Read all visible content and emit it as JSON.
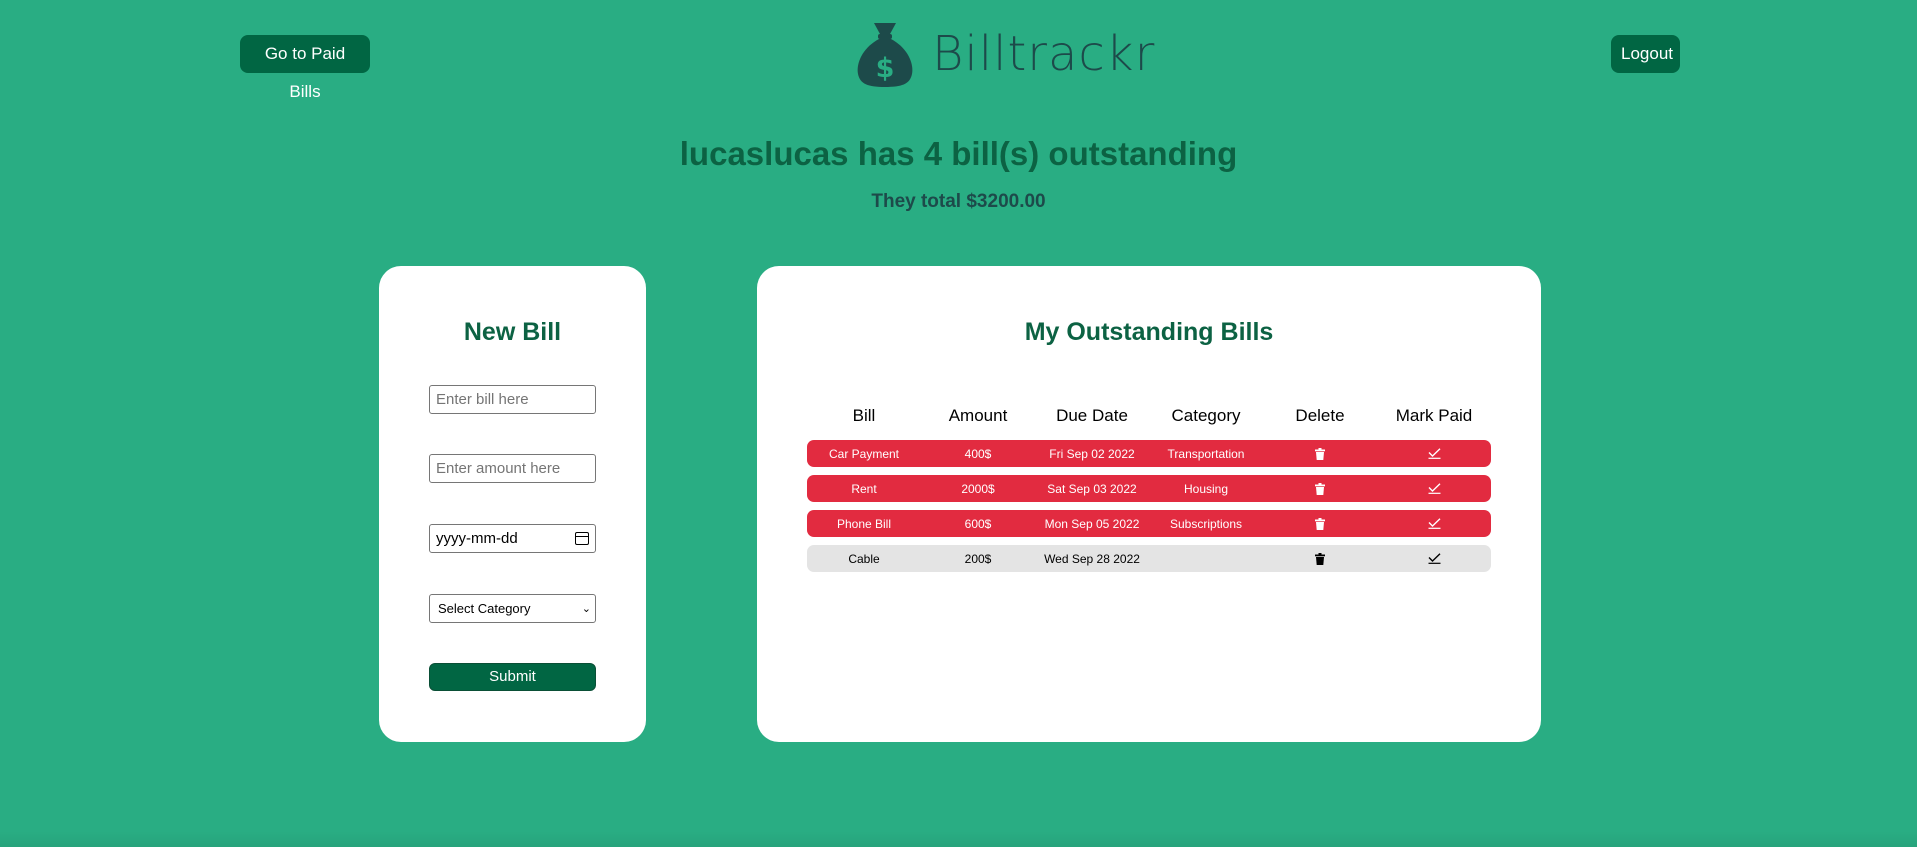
{
  "header": {
    "paid_bills_label": "Go to Paid Bills",
    "brand": "Billtrackr",
    "logout_label": "Logout"
  },
  "summary": {
    "headline": "lucaslucas has 4 bill(s) outstanding",
    "total": "They total $3200.00"
  },
  "new_bill": {
    "title": "New Bill",
    "bill_placeholder": "Enter bill here",
    "amount_placeholder": "Enter amount here",
    "date_placeholder": "yyyy-mm-dd",
    "category_placeholder": "Select Category",
    "submit_label": "Submit"
  },
  "bills": {
    "title": "My Outstanding Bills",
    "columns": [
      "Bill",
      "Amount",
      "Due Date",
      "Category",
      "Delete",
      "Mark Paid"
    ],
    "rows": [
      {
        "bill": "Car Payment",
        "amount": "400$",
        "due": "Fri Sep 02 2022",
        "category": "Transportation",
        "status": "overdue"
      },
      {
        "bill": "Rent",
        "amount": "2000$",
        "due": "Sat Sep 03 2022",
        "category": "Housing",
        "status": "overdue"
      },
      {
        "bill": "Phone Bill",
        "amount": "600$",
        "due": "Mon Sep 05 2022",
        "category": "Subscriptions",
        "status": "overdue"
      },
      {
        "bill": "Cable",
        "amount": "200$",
        "due": "Wed Sep 28 2022",
        "category": "",
        "status": "pending"
      }
    ]
  },
  "colors": {
    "background": "#29ad83",
    "accent": "#016643",
    "overdue": "#e22b40",
    "pending": "#e4e4e4"
  },
  "icons": {
    "logo": "money-bag-icon",
    "delete": "trash-icon",
    "mark_paid": "check-icon"
  }
}
